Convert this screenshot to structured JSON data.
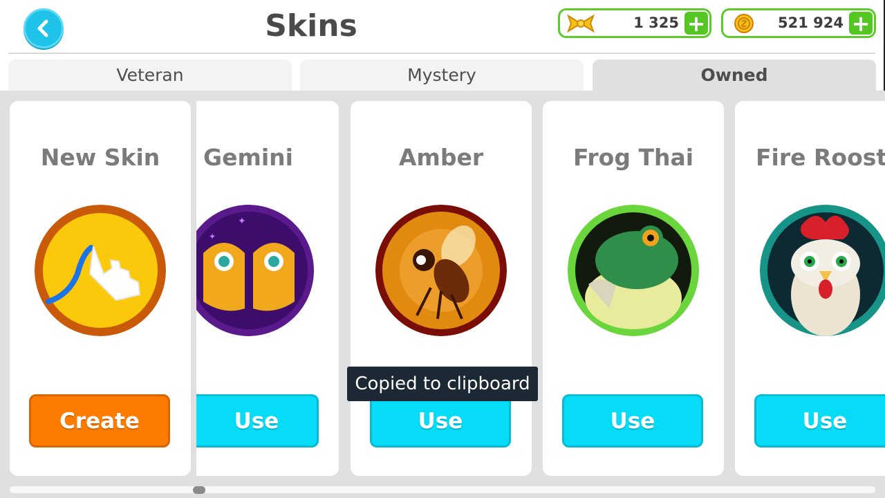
{
  "header": {
    "title": "Skins",
    "back_icon": "chevron-left-icon",
    "currencies": [
      {
        "icon": "bow-icon",
        "amount": "1 325",
        "plus": "+"
      },
      {
        "icon": "coin-icon",
        "amount": "521 924",
        "plus": "+"
      }
    ]
  },
  "tabs": [
    {
      "label": "Veteran",
      "active": false
    },
    {
      "label": "Mystery",
      "active": false
    },
    {
      "label": "Owned",
      "active": true
    }
  ],
  "cards": [
    {
      "name": "New Skin",
      "button": "Create",
      "button_color": "#fd7c00"
    },
    {
      "name": "Gemini",
      "button": "Use",
      "button_color": "#06dbf7"
    },
    {
      "name": "Amber",
      "button": "Use",
      "button_color": "#06dbf7"
    },
    {
      "name": "Frog Thai",
      "button": "Use",
      "button_color": "#06dbf7"
    },
    {
      "name": "Fire Rooste",
      "button": "Use",
      "button_color": "#06dbf7"
    }
  ],
  "toast": "Copied to clipboard",
  "colors": {
    "accent_blue": "#1fc3ea",
    "currency_green": "#55c722",
    "title_gray": "#4a4a4a"
  }
}
